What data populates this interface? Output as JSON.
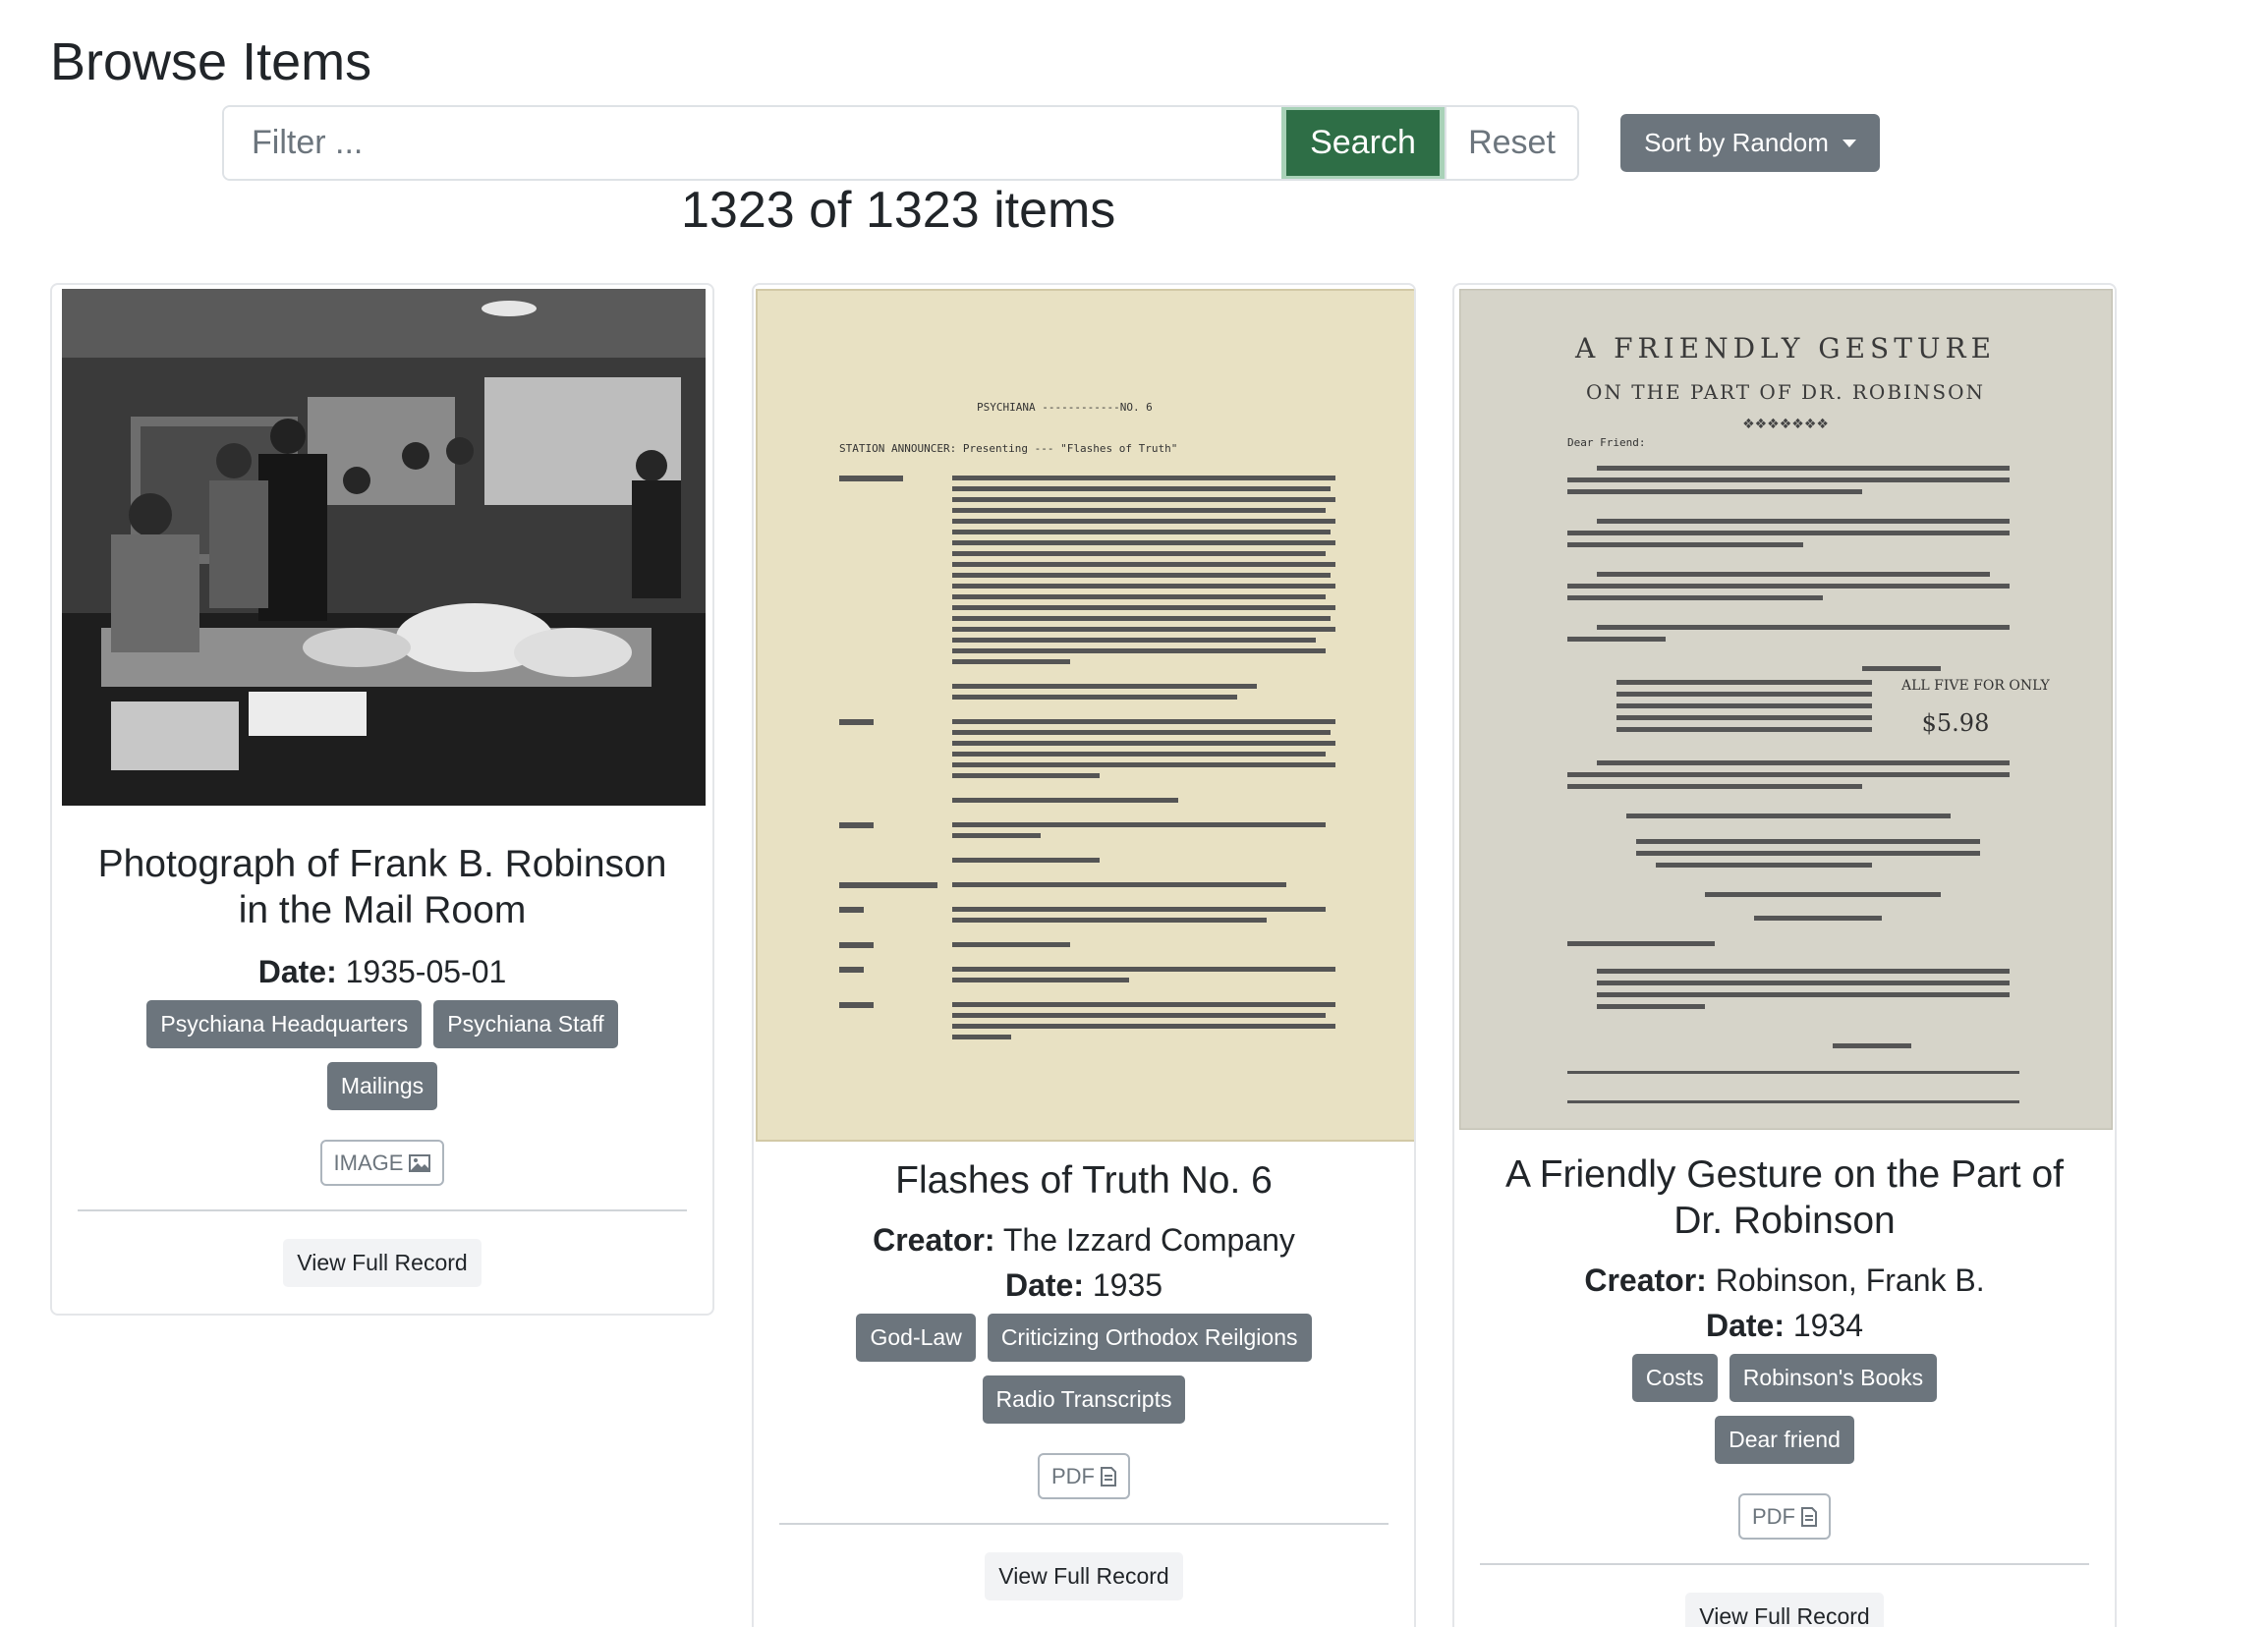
{
  "page": {
    "title": "Browse Items"
  },
  "filter": {
    "placeholder": "Filter ...",
    "search_label": "Search",
    "reset_label": "Reset"
  },
  "sort": {
    "label": "Sort by Random"
  },
  "results": {
    "count_text": "1323 of 1323 items"
  },
  "cards": [
    {
      "title": "Photograph of Frank B. Robinson in the Mail Room",
      "date_label": "Date:",
      "date": "1935-05-01",
      "tags": [
        "Psychiana Headquarters",
        "Psychiana Staff",
        "Mailings"
      ],
      "type": "IMAGE",
      "type_icon": "image-icon",
      "view_label": "View Full Record"
    },
    {
      "title": "Flashes of Truth No. 6",
      "creator_label": "Creator:",
      "creator": "The Izzard Company",
      "date_label": "Date:",
      "date": "1935",
      "tags": [
        "God-Law",
        "Criticizing Orthodox Reilgions",
        "Radio Transcripts"
      ],
      "type": "PDF",
      "type_icon": "document-icon",
      "view_label": "View Full Record",
      "thumb_heading": "PSYCHIANA ------------NO. 6",
      "thumb_subheading": "STATION ANNOUNCER:   Presenting --- \"Flashes of Truth\""
    },
    {
      "title": "A Friendly Gesture on the Part of Dr. Robinson",
      "creator_label": "Creator:",
      "creator": "Robinson, Frank B.",
      "date_label": "Date:",
      "date": "1934",
      "tags": [
        "Costs",
        "Robinson's Books",
        "Dear friend"
      ],
      "type": "PDF",
      "type_icon": "document-icon",
      "view_label": "View Full Record",
      "thumb_heading": "A FRIENDLY GESTURE",
      "thumb_subheading": "ON THE PART OF DR. ROBINSON",
      "thumb_salutation": "Dear Friend:",
      "thumb_offer": "ALL FIVE FOR ONLY",
      "thumb_price": "$5.98"
    }
  ],
  "colors": {
    "search_green": "#2e6e46",
    "tag_gray": "#6c757d",
    "paper_yellow": "#e9e3c6",
    "paper_gray": "#d6d4c9"
  }
}
